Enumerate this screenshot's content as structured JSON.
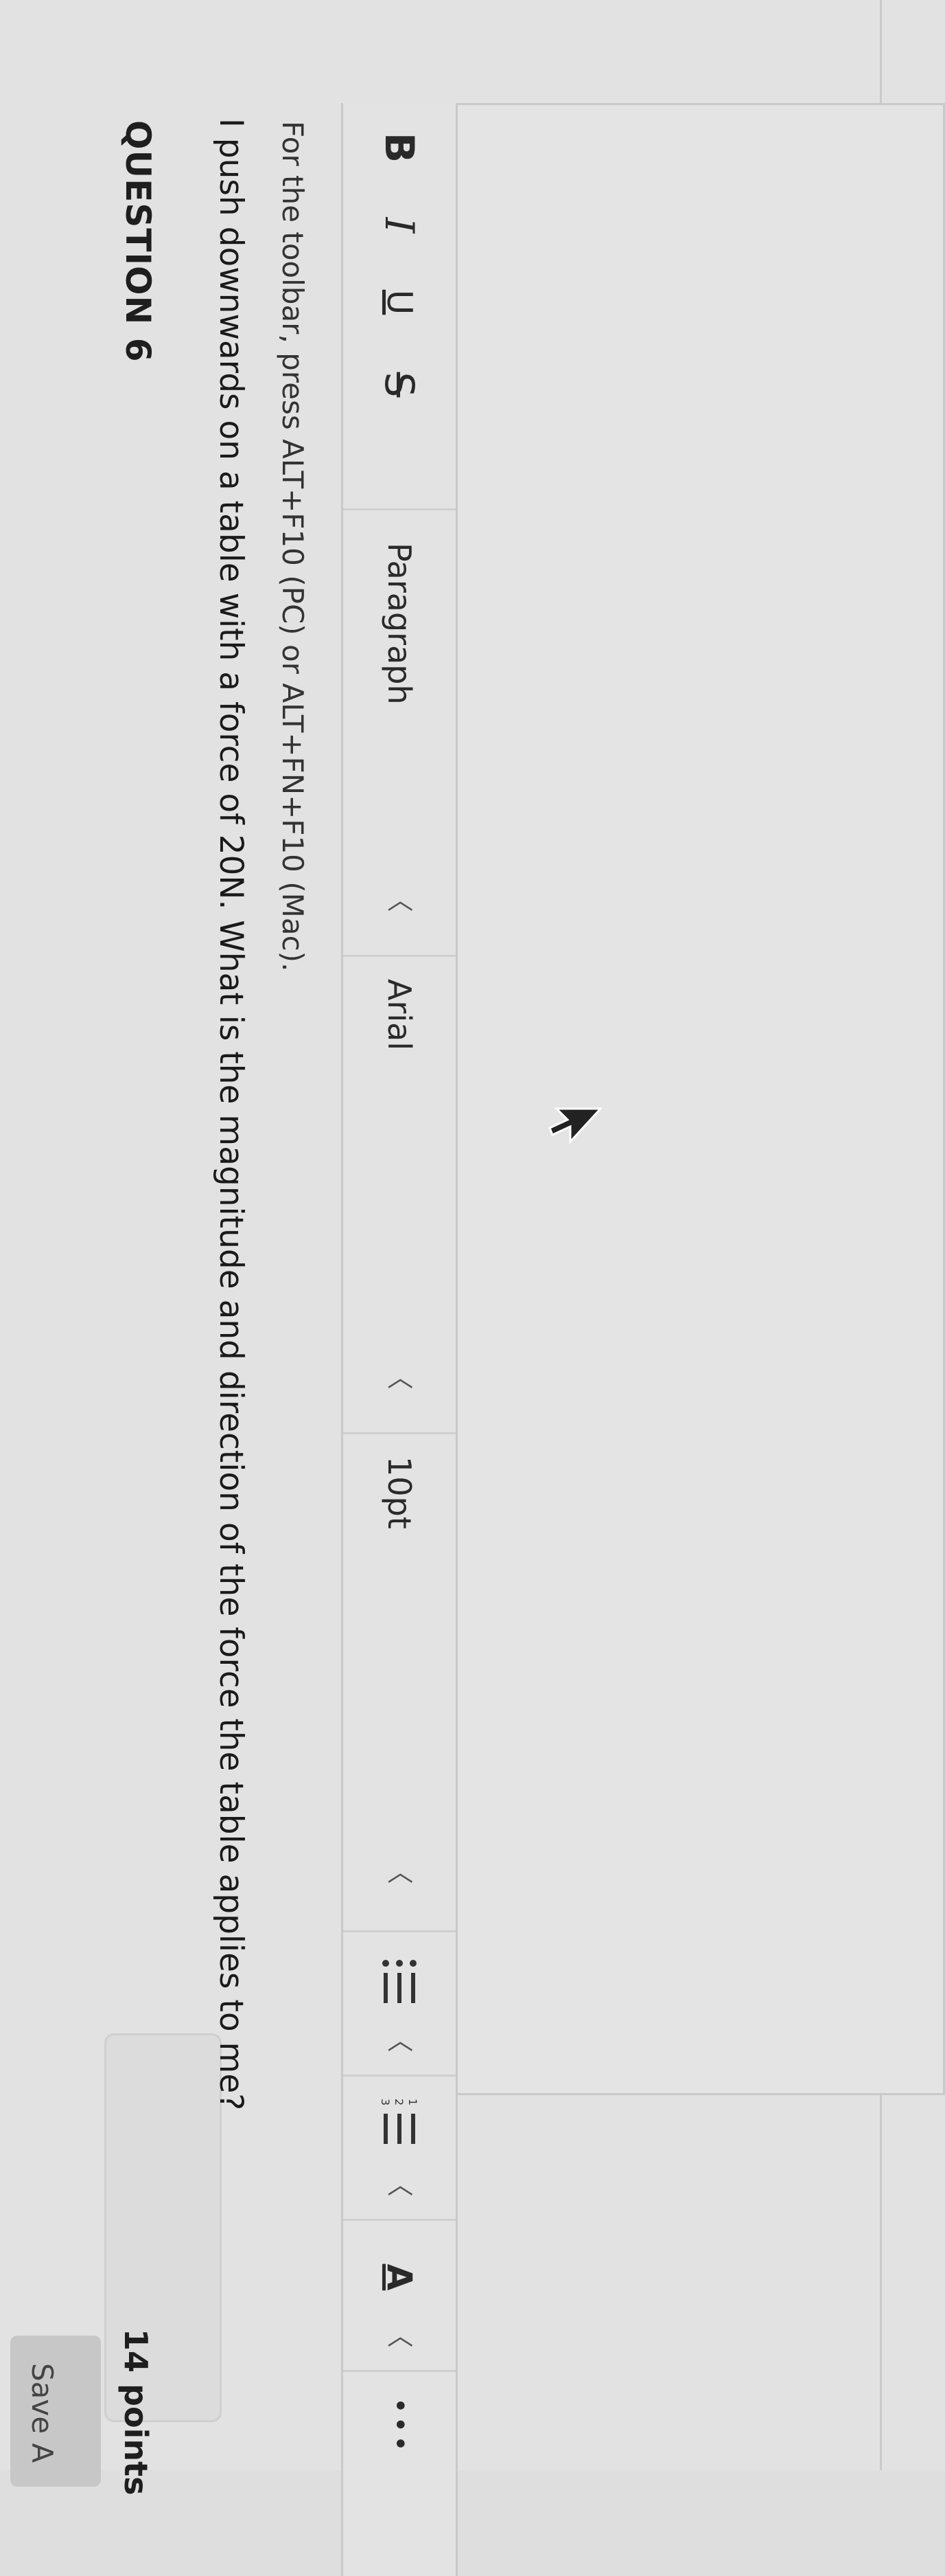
{
  "question": {
    "title": "QUESTION 6",
    "points": "14 points",
    "save_button": "Save A",
    "text": "I push downwards on a table with a force of 20N. What is the magnitude and direction of the force the table applies to me?",
    "toolbar_hint": "For the toolbar, press ALT+F10 (PC) or ALT+FN+F10 (Mac)."
  },
  "toolbar": {
    "bold": "B",
    "italic": "I",
    "underline": "U",
    "strikethrough": "S",
    "paragraph": "Paragraph",
    "font": "Arial",
    "size": "10pt",
    "chevron": "〈",
    "text_color": "A",
    "more": "•••"
  },
  "icons": [
    "bold-icon",
    "italic-icon",
    "underline-icon",
    "strikethrough-icon",
    "bullet-list-icon",
    "numbered-list-icon",
    "text-color-icon",
    "more-icon",
    "mouse-cursor-icon"
  ]
}
